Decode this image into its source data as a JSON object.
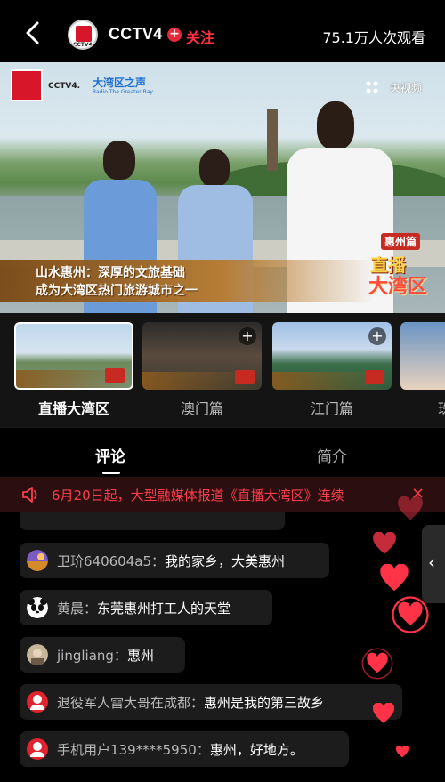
{
  "header": {
    "channel_name": "CCTV4",
    "follow_plus": "+",
    "follow_label": "关注",
    "viewer_count": "75.1万人次观看",
    "channel_logo_text": "CCTV4"
  },
  "video": {
    "logo_text": "CCTV4.",
    "gba_title": "大湾区之声",
    "gba_subtitle": "Radio The Greater Bay",
    "watermark": "央视频",
    "caption_line1": "山水惠州：深厚的文旅基础",
    "caption_line2": "成为大湾区热门旅游城市之一",
    "episode_tag": "惠州篇",
    "show_title_1": "直播",
    "show_title_2": "大湾区"
  },
  "episodes": [
    {
      "label": "直播大湾区",
      "active": true
    },
    {
      "label": "澳门篇",
      "active": false
    },
    {
      "label": "江门篇",
      "active": false
    },
    {
      "label": "珠",
      "active": false
    }
  ],
  "tabs": {
    "comments": "评论",
    "intro": "简介"
  },
  "announcement": {
    "text": "6月20日起，大型融媒体报道《直播大湾区》连续",
    "close": "×"
  },
  "comments": [
    {
      "user": "卫玠640604a5",
      "sep": "：",
      "message": "我的家乡，大美惠州",
      "avatar": "landscape"
    },
    {
      "user": "黄晨",
      "sep": "：",
      "message": "东莞惠州打工人的天堂",
      "avatar": "panda"
    },
    {
      "user": "jingliang",
      "sep": "：",
      "message": "惠州",
      "avatar": "photo"
    },
    {
      "user": "退役军人雷大哥在成都",
      "sep": "：",
      "message": "惠州是我的第三故乡",
      "avatar": "default-red"
    },
    {
      "user": "手机用户139****5950",
      "sep": "：",
      "message": "惠州，好地方。",
      "avatar": "default-red"
    }
  ],
  "side_tab": {
    "chevron": "‹"
  },
  "colors": {
    "accent_red": "#ff2e44",
    "bubble_bg": "#1c1c1c",
    "announce_bg": "#2a0e10"
  }
}
